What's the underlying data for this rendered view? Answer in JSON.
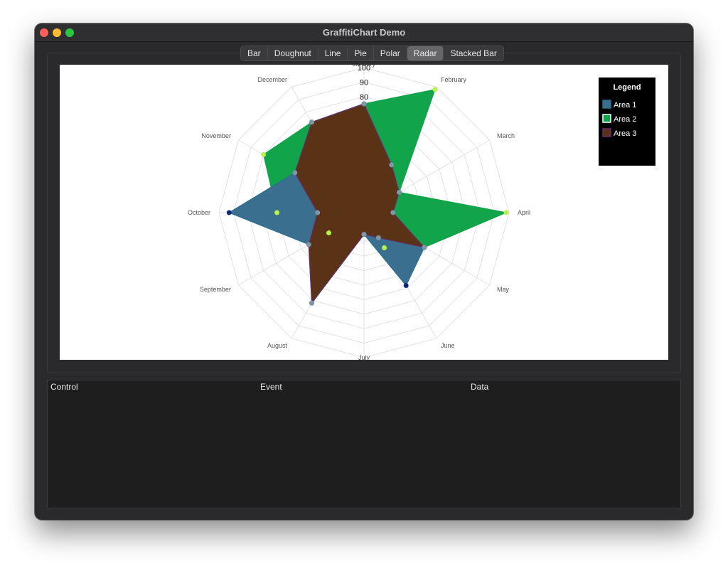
{
  "window": {
    "title": "GraffitiChart Demo"
  },
  "tabs": [
    {
      "label": "Bar",
      "active": false
    },
    {
      "label": "Doughnut",
      "active": false
    },
    {
      "label": "Line",
      "active": false
    },
    {
      "label": "Pie",
      "active": false
    },
    {
      "label": "Polar",
      "active": false
    },
    {
      "label": "Radar",
      "active": true
    },
    {
      "label": "Stacked Bar",
      "active": false
    }
  ],
  "log": {
    "columns": [
      "Control",
      "Event",
      "Data"
    ]
  },
  "chart_data": {
    "type": "radar",
    "categories": [
      "January",
      "February",
      "March",
      "April",
      "May",
      "June",
      "July",
      "August",
      "September",
      "October",
      "November",
      "December"
    ],
    "r_ticks": [
      "100",
      "90",
      "80"
    ],
    "rmax": 100,
    "grid": true,
    "legend": {
      "title": "Legend",
      "position": "top-right"
    },
    "series": [
      {
        "name": "Area 1",
        "color": "#3a6f8f",
        "stroke": "#2e6e8e",
        "point": "#0b2a7a",
        "values": [
          75,
          38,
          28,
          20,
          48,
          58,
          15,
          72,
          44,
          93,
          55,
          72
        ]
      },
      {
        "name": "Area 2",
        "color": "#12a44a",
        "stroke": "#12a44a",
        "point": "#b6f24a",
        "values": [
          75,
          98,
          28,
          98,
          48,
          28,
          15,
          72,
          28,
          60,
          80,
          72
        ]
      },
      {
        "name": "Area 3",
        "color": "#5a3215",
        "stroke": "#6b2a6b",
        "point": "#7f96a6",
        "values": [
          75,
          38,
          28,
          20,
          48,
          20,
          15,
          72,
          44,
          32,
          55,
          72
        ]
      }
    ]
  }
}
